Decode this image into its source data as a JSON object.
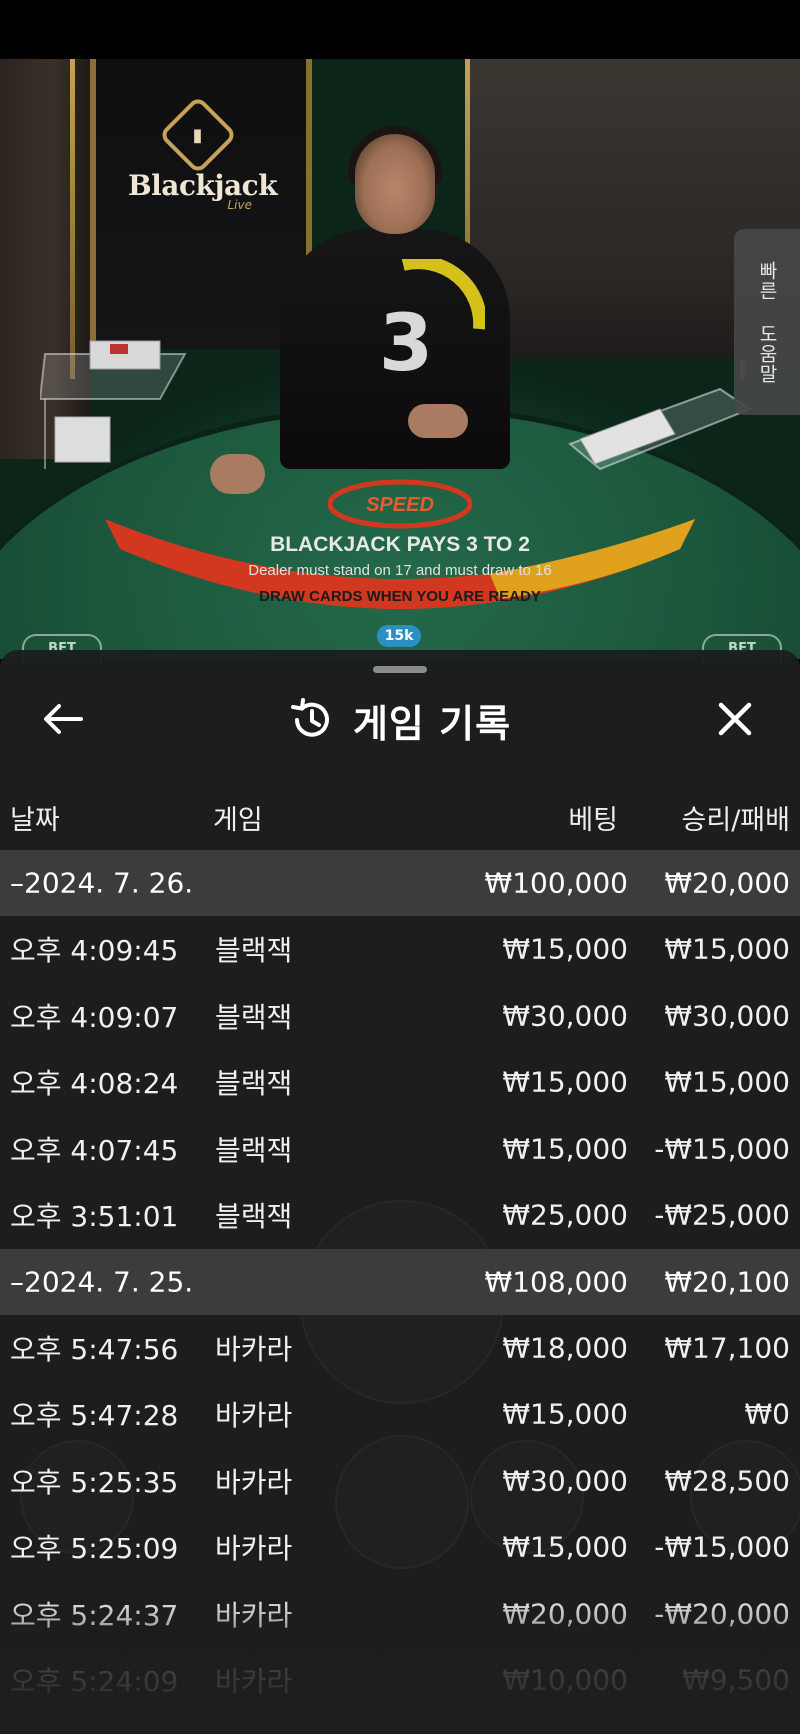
{
  "video": {
    "logo_text": "Blackjack",
    "logo_sub": "Live",
    "countdown": "3",
    "help_tab_label": "빠른 도움말",
    "table_brand": "SPEED",
    "table_line1": "BLACKJACK PAYS 3 TO 2",
    "table_line2": "Dealer must stand on 17 and must draw to 16",
    "table_line3": "DRAW CARDS WHEN YOU ARE READY",
    "chip_value": "15k",
    "seat_left": "BET",
    "seat_right": "BET"
  },
  "panel": {
    "title": "게임 기록",
    "columns": {
      "date": "날짜",
      "game": "게임",
      "bet": "베팅",
      "result": "승리/패배"
    },
    "groups": [
      {
        "date": "–2024. 7. 26.",
        "total_bet": "₩100,000",
        "total_result": "₩20,000",
        "rows": [
          {
            "time": "오후 4:09:45",
            "game": "블랙잭",
            "bet": "₩15,000",
            "result": "₩15,000"
          },
          {
            "time": "오후 4:09:07",
            "game": "블랙잭",
            "bet": "₩30,000",
            "result": "₩30,000"
          },
          {
            "time": "오후 4:08:24",
            "game": "블랙잭",
            "bet": "₩15,000",
            "result": "₩15,000"
          },
          {
            "time": "오후 4:07:45",
            "game": "블랙잭",
            "bet": "₩15,000",
            "result": "-₩15,000"
          },
          {
            "time": "오후 3:51:01",
            "game": "블랙잭",
            "bet": "₩25,000",
            "result": "-₩25,000"
          }
        ]
      },
      {
        "date": "–2024. 7. 25.",
        "total_bet": "₩108,000",
        "total_result": "₩20,100",
        "rows": [
          {
            "time": "오후 5:47:56",
            "game": "바카라",
            "bet": "₩18,000",
            "result": "₩17,100"
          },
          {
            "time": "오후 5:47:28",
            "game": "바카라",
            "bet": "₩15,000",
            "result": "₩0"
          },
          {
            "time": "오후 5:25:35",
            "game": "바카라",
            "bet": "₩30,000",
            "result": "₩28,500"
          },
          {
            "time": "오후 5:25:09",
            "game": "바카라",
            "bet": "₩15,000",
            "result": "-₩15,000"
          },
          {
            "time": "오후 5:24:37",
            "game": "바카라",
            "bet": "₩20,000",
            "result": "-₩20,000"
          },
          {
            "time": "오후 5:24:09",
            "game": "바카라",
            "bet": "₩10,000",
            "result": "₩9,500"
          }
        ]
      }
    ]
  },
  "icons": {
    "back": "arrow-left-icon",
    "close": "close-icon",
    "title": "history-icon"
  },
  "colors": {
    "panel_bg": "#1d1e1f",
    "date_row_bg": "#3b3c3d",
    "text": "#f0f0f0",
    "timer_arc": "#d4c21a"
  }
}
